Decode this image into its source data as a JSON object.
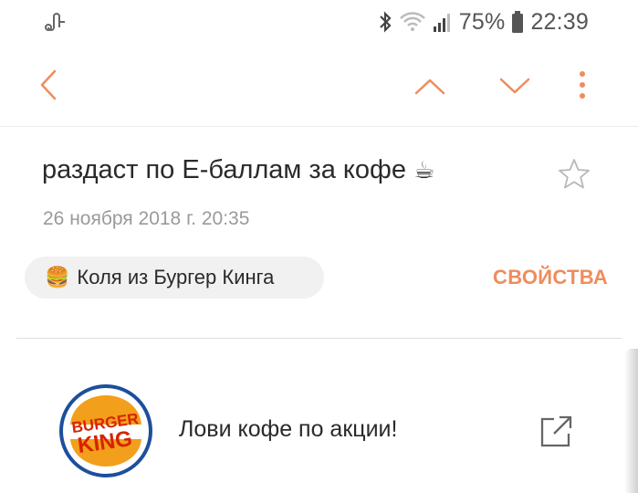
{
  "status_bar": {
    "battery_percent": "75%",
    "time": "22:39",
    "icons": [
      "link-icon",
      "bluetooth-icon",
      "wifi-icon",
      "signal-icon",
      "battery-icon"
    ]
  },
  "toolbar": {
    "icons": [
      "back-arrow-icon",
      "chevron-up-icon",
      "chevron-down-icon",
      "more-vertical-icon"
    ],
    "accent_color": "#ef8c5d"
  },
  "message": {
    "subject": "раздаст по Е-баллам за кофе",
    "subject_emoji": "☕",
    "date": "26 ноября 2018 г.  20:35",
    "sender_emoji": "🍔",
    "sender": "Коля из Бургер Кинга",
    "properties_label": "СВОЙСТВА",
    "body_text": "Лови кофе по акции!"
  },
  "logo": {
    "line1": "BURGER",
    "line2": "KING",
    "colors": {
      "bun": "#f29f1b",
      "ring": "#1c4f9c",
      "text": "#d62300"
    }
  }
}
